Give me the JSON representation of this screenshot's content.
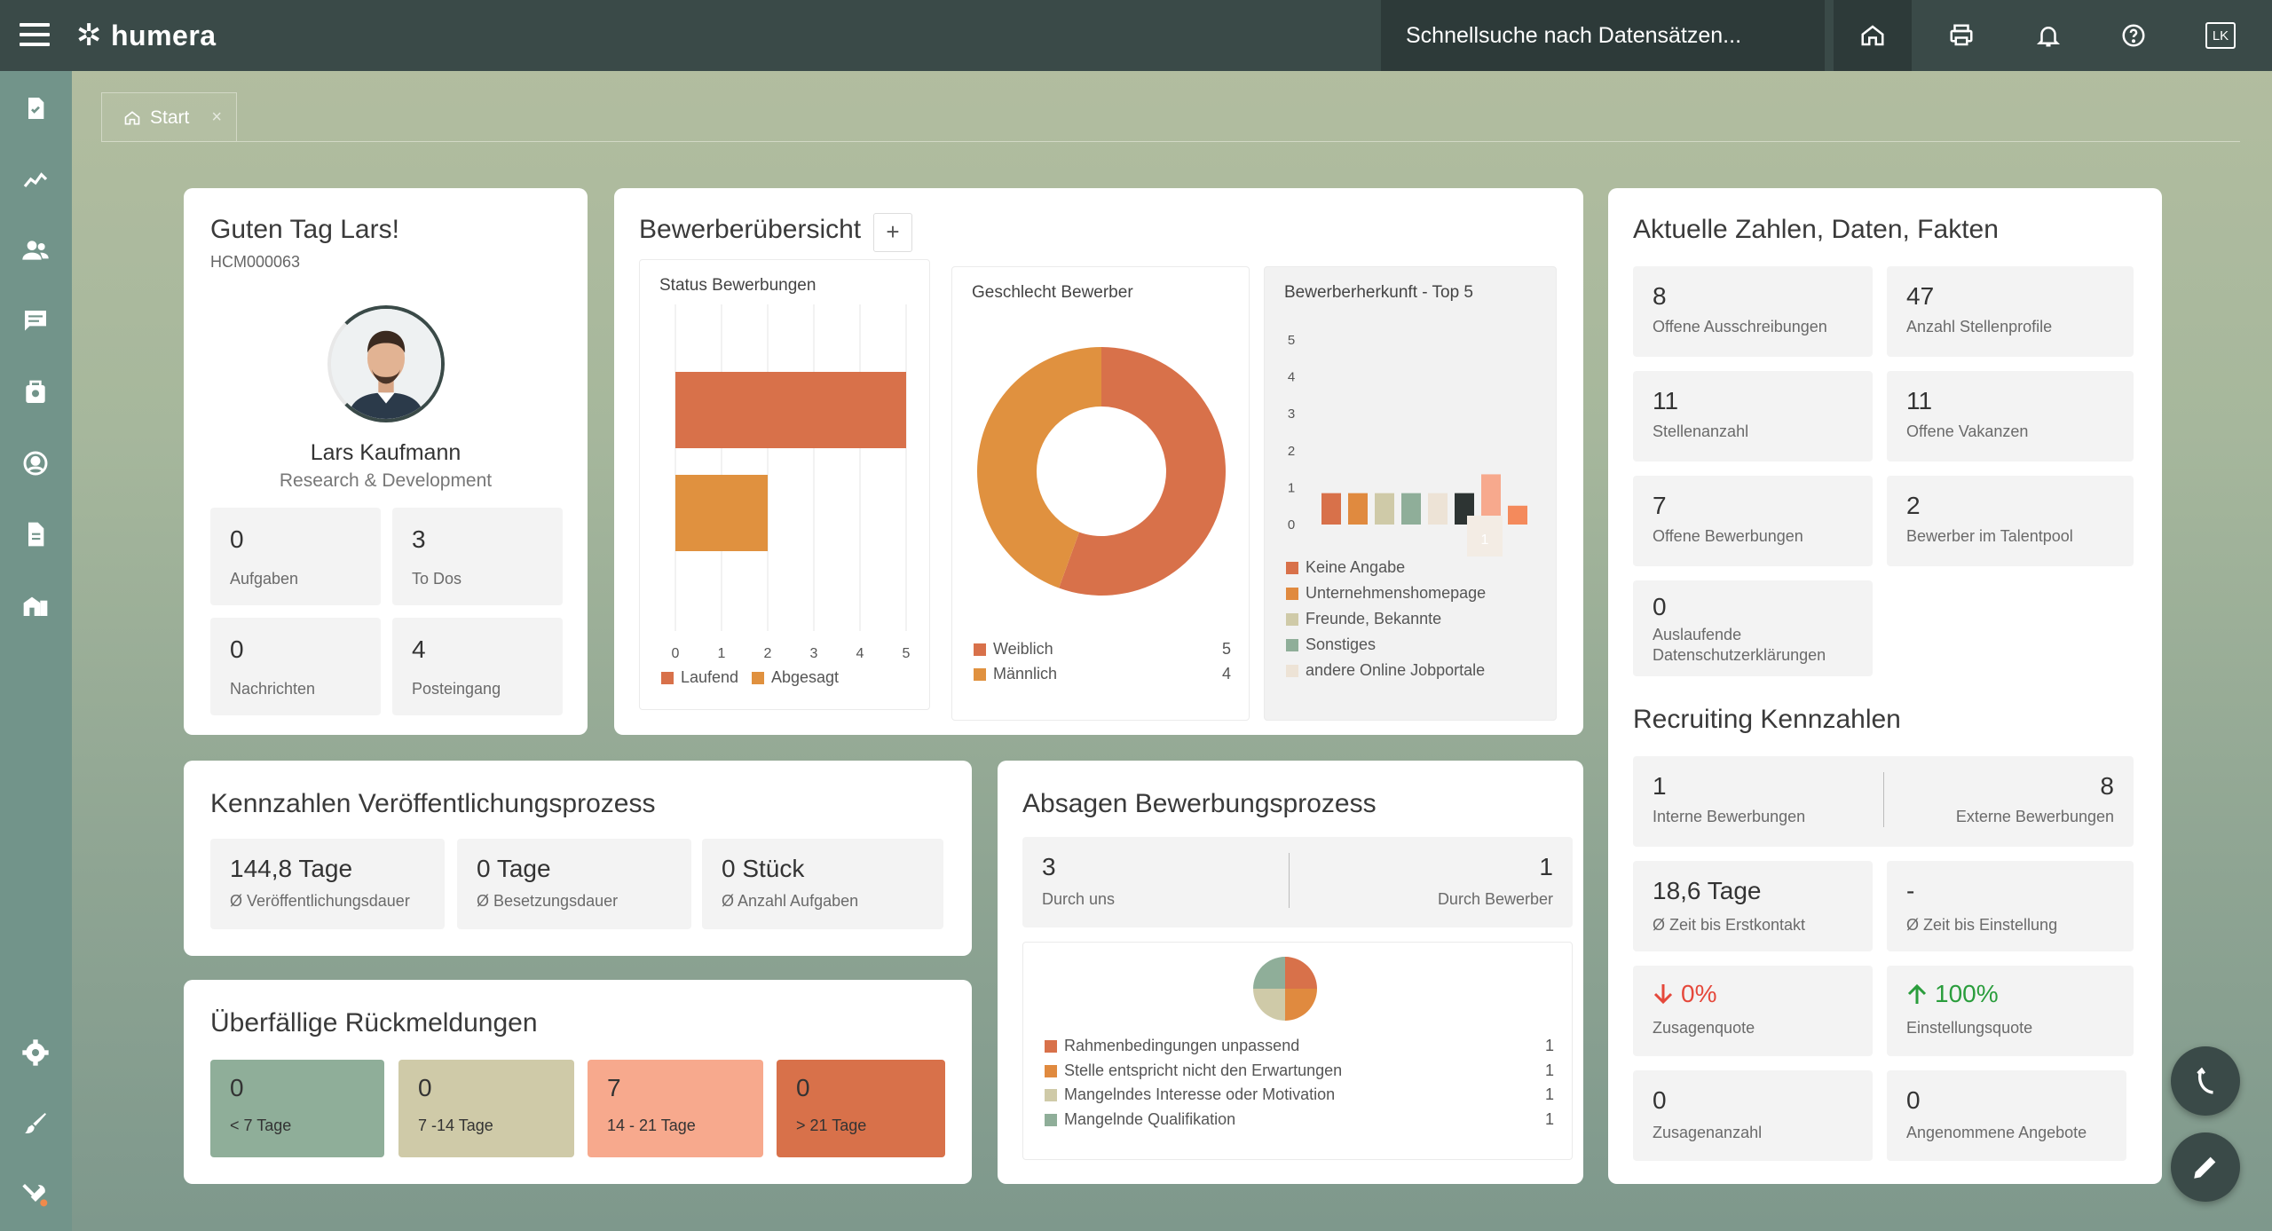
{
  "app": {
    "logo": "humera",
    "search_placeholder": "Schnellsuche nach Datensätzen...",
    "user_initials": "LK"
  },
  "tabs": [
    {
      "label": "Start"
    }
  ],
  "greeting": {
    "title": "Guten Tag Lars!",
    "id": "HCM000063",
    "name": "Lars Kaufmann",
    "department": "Research & Development",
    "tiles": [
      {
        "value": "0",
        "label": "Aufgaben"
      },
      {
        "value": "3",
        "label": "To Dos"
      },
      {
        "value": "0",
        "label": "Nachrichten"
      },
      {
        "value": "4",
        "label": "Posteingang"
      }
    ]
  },
  "applicants": {
    "title": "Bewerberübersicht",
    "add_label": "+",
    "status": {
      "title": "Status Bewerbungen",
      "ticks": [
        "0",
        "1",
        "2",
        "3",
        "4",
        "5"
      ],
      "legend": [
        "Laufend",
        "Abgesagt"
      ]
    },
    "gender": {
      "title": "Geschlecht Bewerber",
      "legend": [
        {
          "label": "Weiblich",
          "value": "5"
        },
        {
          "label": "Männlich",
          "value": "4"
        }
      ]
    },
    "origin": {
      "title": "Bewerberherkunft - Top 5",
      "ticks": [
        "5",
        "4",
        "3",
        "2",
        "1",
        "0"
      ],
      "tooltip": "1",
      "legend": [
        "Keine Angabe",
        "Unternehmenshomepage",
        "Freunde, Bekannte",
        "Sonstiges",
        "andere Online Jobportale"
      ]
    }
  },
  "chart_data": [
    {
      "type": "bar",
      "title": "Status Bewerbungen",
      "orientation": "horizontal",
      "categories": [
        "Laufend",
        "Abgesagt"
      ],
      "values": [
        5,
        2
      ],
      "xlim": [
        0,
        5
      ],
      "colors": [
        "#d8714a",
        "#e0913f"
      ]
    },
    {
      "type": "pie",
      "title": "Geschlecht Bewerber",
      "categories": [
        "Weiblich",
        "Männlich"
      ],
      "values": [
        5,
        4
      ],
      "colors": [
        "#d8714a",
        "#e0913f"
      ]
    },
    {
      "type": "bar",
      "title": "Bewerberherkunft - Top 5",
      "ylim": [
        0,
        5
      ],
      "values": [
        1,
        1,
        1,
        1,
        1,
        1,
        1.6,
        0.6
      ],
      "colors": [
        "#d8714a",
        "#e08a3f",
        "#cfcaa8",
        "#8fae99",
        "#ede3d6",
        "#2d3433",
        "#f7a98d",
        "#f48a5c"
      ]
    },
    {
      "type": "pie",
      "title": "Absagen Bewerbungsprozess",
      "categories": [
        "Rahmenbedingungen unpassend",
        "Stelle entspricht nicht den Erwartungen",
        "Mangelndes Interesse oder Motivation",
        "Mangelnde Qualifikation"
      ],
      "values": [
        1,
        1,
        1,
        1
      ],
      "colors": [
        "#d8714a",
        "#e08a3f",
        "#cfcaa8",
        "#8fae99"
      ]
    }
  ],
  "facts": {
    "title": "Aktuelle Zahlen, Daten, Fakten",
    "tiles": [
      {
        "value": "8",
        "label": "Offene Ausschreibungen"
      },
      {
        "value": "47",
        "label": "Anzahl Stellenprofile"
      },
      {
        "value": "11",
        "label": "Stellenanzahl"
      },
      {
        "value": "11",
        "label": "Offene Vakanzen"
      },
      {
        "value": "7",
        "label": "Offene Bewerbungen"
      },
      {
        "value": "2",
        "label": "Bewerber im Talentpool"
      },
      {
        "value": "0",
        "label": "Auslaufende Datenschutzerklärungen"
      }
    ]
  },
  "recruiting": {
    "title": "Recruiting Kennzahlen",
    "internal": {
      "value": "1",
      "label": "Interne Bewerbungen"
    },
    "external": {
      "value": "8",
      "label": "Externe Bewerbungen"
    },
    "contact": {
      "value": "18,6 Tage",
      "label": "Ø Zeit bis Erstkontakt"
    },
    "hire": {
      "value": "-",
      "label": "Ø Zeit bis Einstellung"
    },
    "commit_rate": {
      "value": "0%",
      "label": "Zusagenquote",
      "color": "#e5483b"
    },
    "hire_rate": {
      "value": "100%",
      "label": "Einstellungsquote",
      "color": "#2a9d3c"
    },
    "commits": {
      "value": "0",
      "label": "Zusagenanzahl"
    },
    "offers": {
      "value": "0",
      "label": "Angenommene Angebote"
    }
  },
  "publishing": {
    "title": "Kennzahlen Veröffentlichungsprozess",
    "tiles": [
      {
        "value": "144,8 Tage",
        "label": "Ø Veröffentlichungsdauer"
      },
      {
        "value": "0 Tage",
        "label": "Ø Besetzungsdauer"
      },
      {
        "value": "0 Stück",
        "label": "Ø Anzahl Aufgaben"
      }
    ]
  },
  "rejections": {
    "title": "Absagen Bewerbungsprozess",
    "by_us": {
      "value": "3",
      "label": "Durch uns"
    },
    "by_applicant": {
      "value": "1",
      "label": "Durch Bewerber"
    },
    "legend": [
      {
        "label": "Rahmenbedingungen unpassend",
        "value": "1"
      },
      {
        "label": "Stelle entspricht nicht den Erwartungen",
        "value": "1"
      },
      {
        "label": "Mangelndes Interesse oder Motivation",
        "value": "1"
      },
      {
        "label": "Mangelnde Qualifikation",
        "value": "1"
      }
    ]
  },
  "overdue": {
    "title": "Überfällige Rückmeldungen",
    "tiles": [
      {
        "value": "0",
        "label": "< 7 Tage",
        "color": "#8fae99"
      },
      {
        "value": "0",
        "label": "7 -14 Tage",
        "color": "#cfcaa8"
      },
      {
        "value": "7",
        "label": "14 - 21 Tage",
        "color": "#f7a98d"
      },
      {
        "value": "0",
        "label": "> 21 Tage",
        "color": "#d8714a"
      }
    ]
  }
}
